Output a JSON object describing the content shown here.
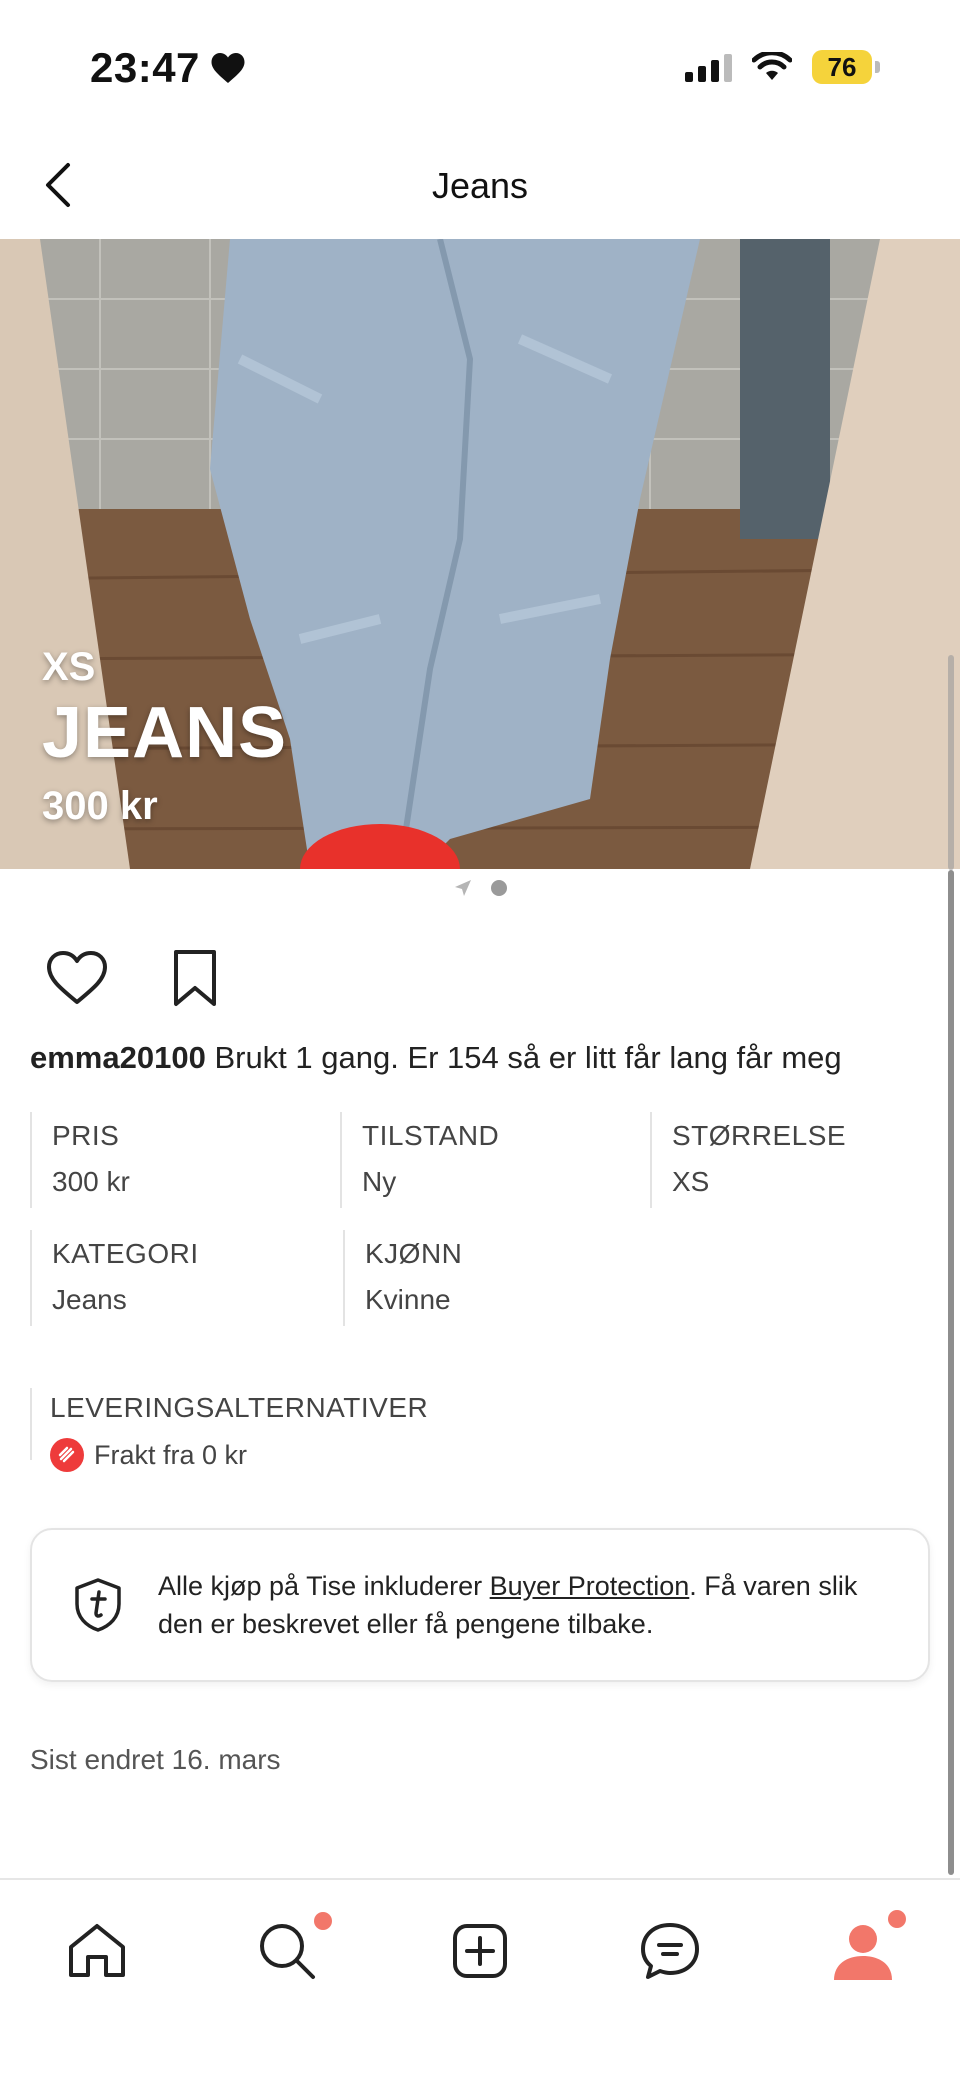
{
  "status_bar": {
    "time": "23:47",
    "battery": "76"
  },
  "header": {
    "title": "Jeans"
  },
  "hero": {
    "size": "XS",
    "title": "JEANS",
    "price": "300 kr"
  },
  "post": {
    "username": "emma20100",
    "description": " Brukt 1 gang. Er 154 så er litt får lang får meg"
  },
  "details": [
    {
      "label": "PRIS",
      "value": "300 kr"
    },
    {
      "label": "TILSTAND",
      "value": "Ny"
    },
    {
      "label": "STØRRELSE",
      "value": "XS"
    },
    {
      "label": "KATEGORI",
      "value": "Jeans"
    },
    {
      "label": "KJØNN",
      "value": "Kvinne"
    }
  ],
  "delivery": {
    "label": "LEVERINGSALTERNATIVER",
    "option": "Frakt fra 0 kr"
  },
  "protection": {
    "text_before": "Alle kjøp på Tise inkluderer ",
    "link": "Buyer Protection",
    "text_after": ". Få varen slik den er beskrevet eller få pengene tilbake."
  },
  "last_edited": "Sist endret 16. mars",
  "colors": {
    "accent": "#f2776a",
    "battery": "#f5d33b",
    "delivery_badge": "#ee3b3b"
  },
  "tabbar": {
    "tabs": [
      "home-icon",
      "search-icon",
      "add-icon",
      "chat-icon",
      "profile-icon"
    ]
  }
}
